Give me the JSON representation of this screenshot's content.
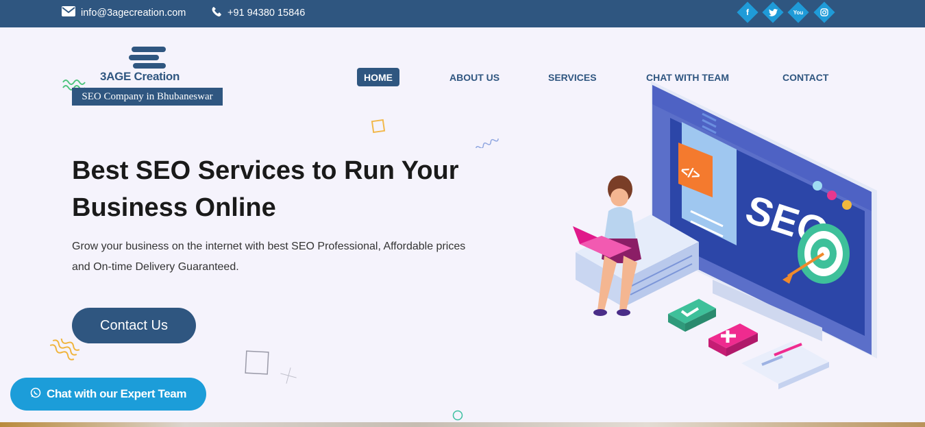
{
  "topbar": {
    "email": "info@3agecreation.com",
    "phone": "+91 94380 15846",
    "social": [
      {
        "icon": "facebook-icon",
        "glyph": "f"
      },
      {
        "icon": "twitter-icon",
        "glyph": "t"
      },
      {
        "icon": "youtube-icon",
        "glyph": "You"
      },
      {
        "icon": "instagram-icon",
        "glyph": "◎"
      }
    ]
  },
  "logo": {
    "brand": "3AGE Creation",
    "tagline": "SEO Company in Bhubaneswar"
  },
  "nav": {
    "items": [
      {
        "label": "HOME",
        "active": true
      },
      {
        "label": "ABOUT US",
        "active": false
      },
      {
        "label": "SERVICES",
        "active": false
      },
      {
        "label": "CHAT WITH TEAM",
        "active": false
      },
      {
        "label": "CONTACT",
        "active": false
      }
    ]
  },
  "hero": {
    "title_line1": "Best SEO Services to Run Your",
    "title_line2": "Business Online",
    "subtitle_line1": "Grow your business on the internet with best SEO Professional, Affordable prices",
    "subtitle_line2": "and On-time Delivery Guaranteed.",
    "cta_label": "Contact Us"
  },
  "illustration": {
    "screen_text": "SEO",
    "code_symbol": "</>"
  },
  "chat_widget": {
    "label": "Chat with our Expert Team",
    "icon": "whatsapp-icon"
  },
  "colors": {
    "primary": "#2f5680",
    "accent": "#1f9bd8",
    "background": "#f5f3fc"
  }
}
